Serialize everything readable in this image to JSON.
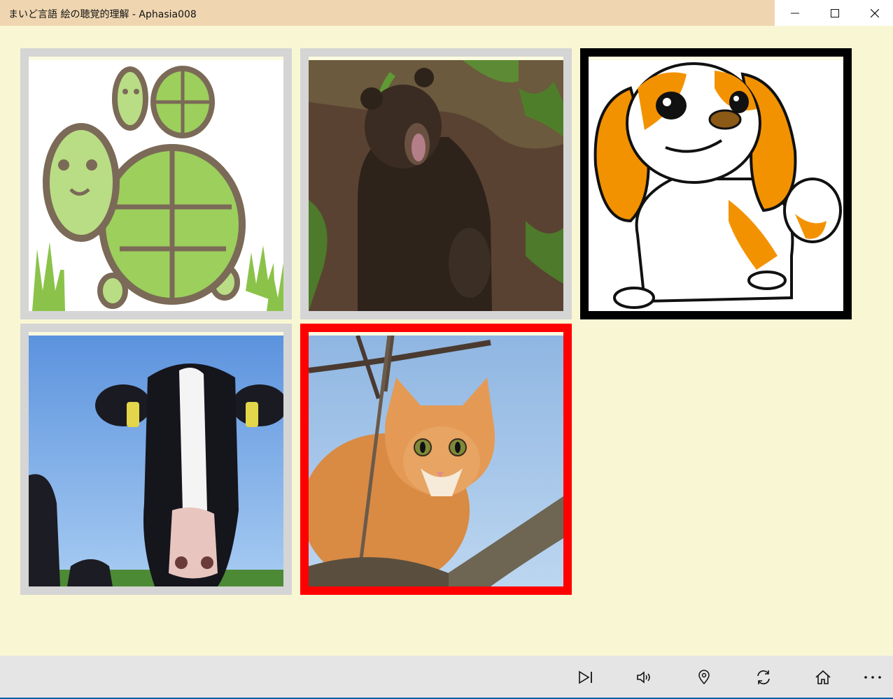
{
  "window": {
    "title": "まいど言語 絵の聴覚的理解 - Aphasia008",
    "controls": [
      "minimize-icon",
      "maximize-icon",
      "close-icon"
    ]
  },
  "grid": {
    "tiles": [
      {
        "subject": "turtle",
        "state": "normal"
      },
      {
        "subject": "bear",
        "state": "normal"
      },
      {
        "subject": "dog",
        "state": "highlight"
      },
      {
        "subject": "cow",
        "state": "normal"
      },
      {
        "subject": "cat",
        "state": "selected"
      }
    ]
  },
  "colors": {
    "background": "#f9f7d3",
    "titlebar": "#efd6b1",
    "tile_border": "#d5d5d5",
    "highlight_border": "#000000",
    "selected_border": "#ff0000",
    "command_bar": "#e5e5e5"
  },
  "command_bar": {
    "buttons": [
      "skip-next-icon",
      "speaker-icon",
      "map-pin-icon",
      "refresh-icon",
      "home-icon",
      "more-icon"
    ]
  }
}
